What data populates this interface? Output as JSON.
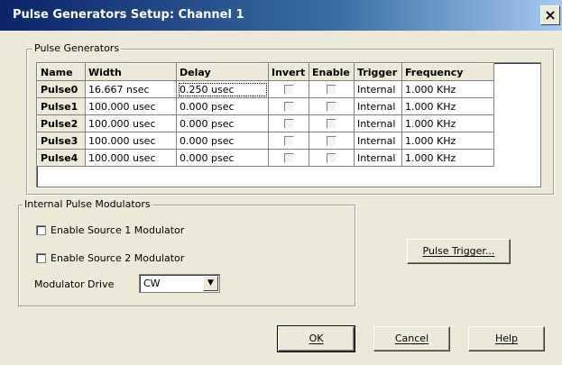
{
  "window": {
    "title": "Pulse Generators Setup: Channel 1",
    "close_glyph": "×"
  },
  "pulse_generators": {
    "legend": "Pulse Generators",
    "columns": [
      "Name",
      "Width",
      "Delay",
      "Invert",
      "Enable",
      "Trigger",
      "Frequency"
    ],
    "rows": [
      {
        "name": "Pulse0",
        "width": "16.667 nsec",
        "delay": "0.250 usec",
        "invert": false,
        "enable": false,
        "trigger": "Internal",
        "frequency": "1.000 KHz"
      },
      {
        "name": "Pulse1",
        "width": "100.000 usec",
        "delay": "0.000 psec",
        "invert": false,
        "enable": false,
        "trigger": "Internal",
        "frequency": "1.000 KHz"
      },
      {
        "name": "Pulse2",
        "width": "100.000 usec",
        "delay": "0.000 psec",
        "invert": false,
        "enable": false,
        "trigger": "Internal",
        "frequency": "1.000 KHz"
      },
      {
        "name": "Pulse3",
        "width": "100.000 usec",
        "delay": "0.000 psec",
        "invert": false,
        "enable": false,
        "trigger": "Internal",
        "frequency": "1.000 KHz"
      },
      {
        "name": "Pulse4",
        "width": "100.000 usec",
        "delay": "0.000 psec",
        "invert": false,
        "enable": false,
        "trigger": "Internal",
        "frequency": "1.000 KHz"
      }
    ]
  },
  "modulators": {
    "legend": "Internal Pulse Modulators",
    "source1_label": "Enable Source 1 Modulator",
    "source1_checked": false,
    "source2_label": "Enable Source 2 Modulator",
    "source2_checked": false,
    "drive_label": "Modulator Drive",
    "drive_value": "CW",
    "dropdown_icon": "chevron-down-icon"
  },
  "buttons": {
    "pulse_trigger": "Pulse Trigger...",
    "ok": "OK",
    "cancel": "Cancel",
    "help": "Help"
  }
}
